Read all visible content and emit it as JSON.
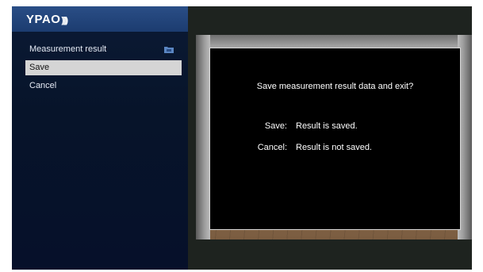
{
  "app": {
    "logo_text": "YPAO",
    "logo_suffix": "))))"
  },
  "menu": {
    "items": [
      {
        "label": "Measurement result",
        "icon": "folder-icon"
      },
      {
        "label": "Save",
        "selected": true
      },
      {
        "label": "Cancel"
      }
    ]
  },
  "dialog": {
    "question": "Save measurement result data and exit?",
    "options": [
      {
        "label": "Save:",
        "desc": "Result is saved."
      },
      {
        "label": "Cancel:",
        "desc": "Result is not saved."
      }
    ]
  },
  "colors": {
    "header_blue": "#2a4e86",
    "panel_navy": "#07142a",
    "selected_bg": "#d5d5d5",
    "dialog_bg": "#000000",
    "folder_icon": "#5b86c2"
  }
}
